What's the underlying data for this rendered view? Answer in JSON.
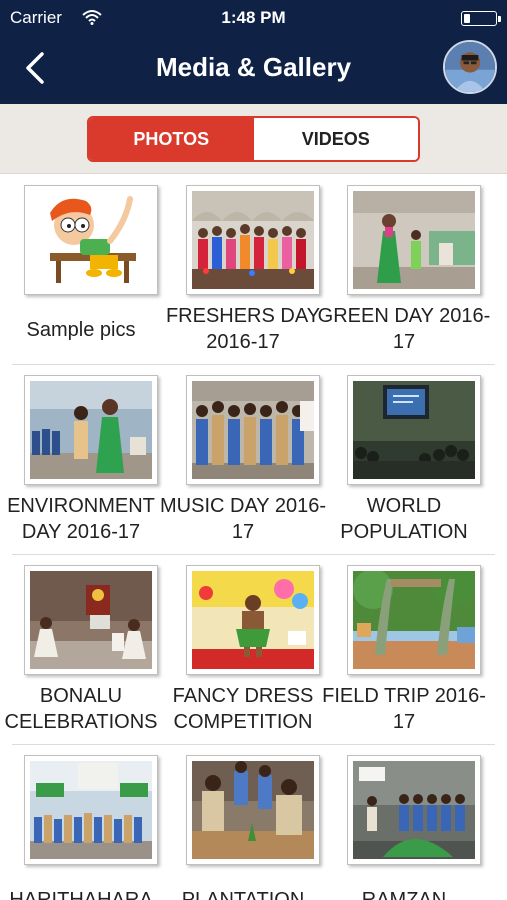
{
  "status_bar": {
    "carrier": "Carrier",
    "time": "1:48 PM"
  },
  "header": {
    "title": "Media & Gallery",
    "back_icon": "chevron-left-icon",
    "avatar": "user-avatar"
  },
  "tabs": [
    {
      "label": "PHOTOS",
      "active": true
    },
    {
      "label": "VIDEOS",
      "active": false
    }
  ],
  "colors": {
    "header_bg": "#0f2246",
    "accent": "#d93a2b",
    "segment_bg": "#ece9e5"
  },
  "albums": [
    {
      "caption": "Sample pics"
    },
    {
      "caption": "FRESHERS DAY 2016-17"
    },
    {
      "caption": "GREEN DAY 2016-17"
    },
    {
      "caption": "ENVIRONMENT DAY 2016-17"
    },
    {
      "caption": "MUSIC DAY 2016-17"
    },
    {
      "caption": "WORLD POPULATION"
    },
    {
      "caption": "BONALU CELEBRATIONS"
    },
    {
      "caption": "FANCY DRESS COMPETITION"
    },
    {
      "caption": "FIELD TRIP 2016-17"
    },
    {
      "caption": "HARITHAHARA"
    },
    {
      "caption": "PLANTATION"
    },
    {
      "caption": "RAMZAN"
    }
  ]
}
